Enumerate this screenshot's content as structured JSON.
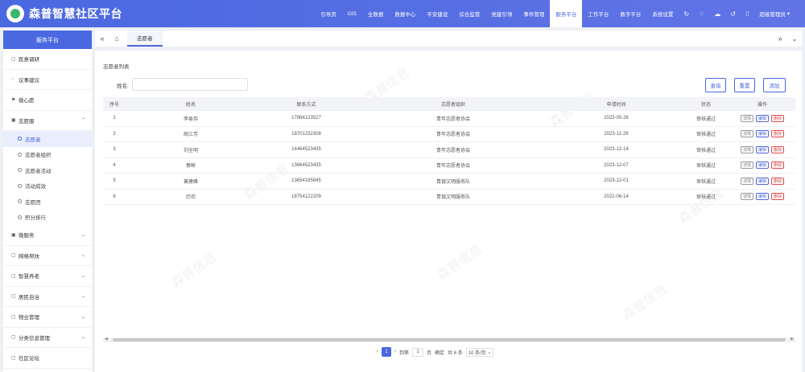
{
  "app": {
    "title": "森普智慧社区平台"
  },
  "topnav": {
    "items": [
      {
        "label": "引导页",
        "active": false
      },
      {
        "label": "GIS",
        "active": false
      },
      {
        "label": "全数据",
        "active": false
      },
      {
        "label": "数据中心",
        "active": false
      },
      {
        "label": "平安建设",
        "active": false
      },
      {
        "label": "综合监管",
        "active": false
      },
      {
        "label": "党建引领",
        "active": false
      },
      {
        "label": "事件管理",
        "active": false
      },
      {
        "label": "服务平台",
        "active": true
      },
      {
        "label": "工作平台",
        "active": false
      },
      {
        "label": "数字平台",
        "active": false
      },
      {
        "label": "系统设置",
        "active": false
      }
    ],
    "icons": [
      "refresh-icon",
      "bell-icon",
      "cloud-icon",
      "history-icon",
      "grid-icon"
    ],
    "user_label": "超级管理员"
  },
  "sidebar": {
    "header": "服务平台",
    "items": [
      {
        "label": "民意调研",
        "icon": "doc-icon"
      },
      {
        "label": "议事建议",
        "icon": "chat-icon"
      },
      {
        "label": "微心愿",
        "icon": "flag-icon"
      },
      {
        "label": "志愿服",
        "icon": "folder-icon",
        "expanded": true
      }
    ],
    "subitems": [
      {
        "label": "志愿者",
        "active": true
      },
      {
        "label": "志愿者组织",
        "active": false
      },
      {
        "label": "志愿者活动",
        "active": false
      },
      {
        "label": "活动成效",
        "active": false
      },
      {
        "label": "志愿团",
        "active": false
      },
      {
        "label": "积分排行",
        "active": false
      }
    ],
    "items_after": [
      {
        "label": "微服务",
        "icon": "folder-icon"
      },
      {
        "label": "网格帮扶",
        "icon": "doc-icon"
      },
      {
        "label": "智慧养老",
        "icon": "doc-icon"
      },
      {
        "label": "居民自治",
        "icon": "doc-icon"
      },
      {
        "label": "物业管理",
        "icon": "doc-icon"
      },
      {
        "label": "分类信息管理",
        "icon": "doc-icon"
      },
      {
        "label": "社区论坛",
        "icon": "doc-icon"
      }
    ]
  },
  "tabbar": {
    "tab_label": "志愿者"
  },
  "main": {
    "panel_title": "志愿者列表",
    "search_label": "姓名:",
    "search_value": "",
    "buttons": {
      "query": "查询",
      "reset": "重置",
      "add": "添加"
    }
  },
  "table": {
    "headers": [
      "序号",
      "姓名",
      "联系方式",
      "志愿者组织",
      "申请时间",
      "状态",
      "操作"
    ],
    "rows": [
      {
        "no": "1",
        "name": "李易伟",
        "phone": "17864123527",
        "org": "青年志愿者协会",
        "date": "2023-05-26",
        "status": "审核通过"
      },
      {
        "no": "2",
        "name": "胡三芳",
        "phone": "18701232308",
        "org": "青年志愿者协会",
        "date": "2023-11-29",
        "status": "审核通过"
      },
      {
        "no": "3",
        "name": "刘全明",
        "phone": "14464523435",
        "org": "青年志愿者协会",
        "date": "2023-12-14",
        "status": "审核通过"
      },
      {
        "no": "4",
        "name": "蔡晰",
        "phone": "13664523435",
        "org": "青年志愿者协会",
        "date": "2023-12-07",
        "status": "审核通过"
      },
      {
        "no": "5",
        "name": "黄建峰",
        "phone": "13654185845",
        "org": "青银文明服务队",
        "date": "2023-12-01",
        "status": "审核通过"
      },
      {
        "no": "6",
        "name": "历欢",
        "phone": "18754122209",
        "org": "青银文明服务队",
        "date": "2022-06-14",
        "status": "审核通过"
      }
    ],
    "ops": {
      "detail": "详情",
      "edit": "编辑",
      "delete": "删除"
    }
  },
  "pager": {
    "current": "1",
    "goto_label": "到第",
    "goto_value": "1",
    "page_unit": "页",
    "confirm": "确定",
    "total": "共 6 条",
    "page_size": "10 条/页"
  },
  "watermark": "森普信息"
}
